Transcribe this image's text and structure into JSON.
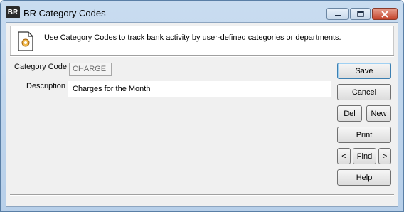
{
  "window": {
    "app_icon_text": "BR",
    "title": "BR Category Codes"
  },
  "header": {
    "description": "Use Category Codes to track bank activity by user-defined categories or departments."
  },
  "form": {
    "category_code_label": "Category Code",
    "category_code_value": "CHARGE",
    "description_label": "Description",
    "description_value": "Charges for the Month"
  },
  "buttons": {
    "save": "Save",
    "cancel": "Cancel",
    "del": "Del",
    "new": "New",
    "print": "Print",
    "prev": "<",
    "find": "Find",
    "next": ">",
    "help": "Help"
  }
}
